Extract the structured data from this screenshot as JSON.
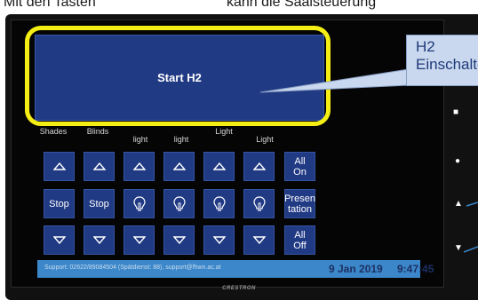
{
  "caption": {
    "left": "Mit den Tasten",
    "right": "kann die Saalsteuerung"
  },
  "main_button": {
    "label": "Start H2"
  },
  "callout": {
    "line1": "H2",
    "line2": "Einschalten"
  },
  "columns": [
    {
      "label": "Shades",
      "sub": ""
    },
    {
      "label": "Blinds",
      "sub": ""
    },
    {
      "label": "",
      "sub": "light"
    },
    {
      "label": "",
      "sub": "light"
    },
    {
      "label": "Light",
      "sub": ""
    },
    {
      "label": "",
      "sub": "Light"
    }
  ],
  "grid": {
    "stop_label": "Stop",
    "all_on": "All\nOn",
    "presentation": "Presen\ntation",
    "all_off": "All\nOff"
  },
  "status": {
    "support": "Support: 02622/89084504 (Spätdienst: 88), support@fhwn.ac.at",
    "date": "9 Jan 2019",
    "time": "9:47:45"
  },
  "brand": "CRESTRON",
  "colors": {
    "button_blue": "#213a84",
    "highlight_yellow": "#f5ee14",
    "status_blue": "#3b87c9",
    "callout_bg": "#c9d8ee"
  }
}
